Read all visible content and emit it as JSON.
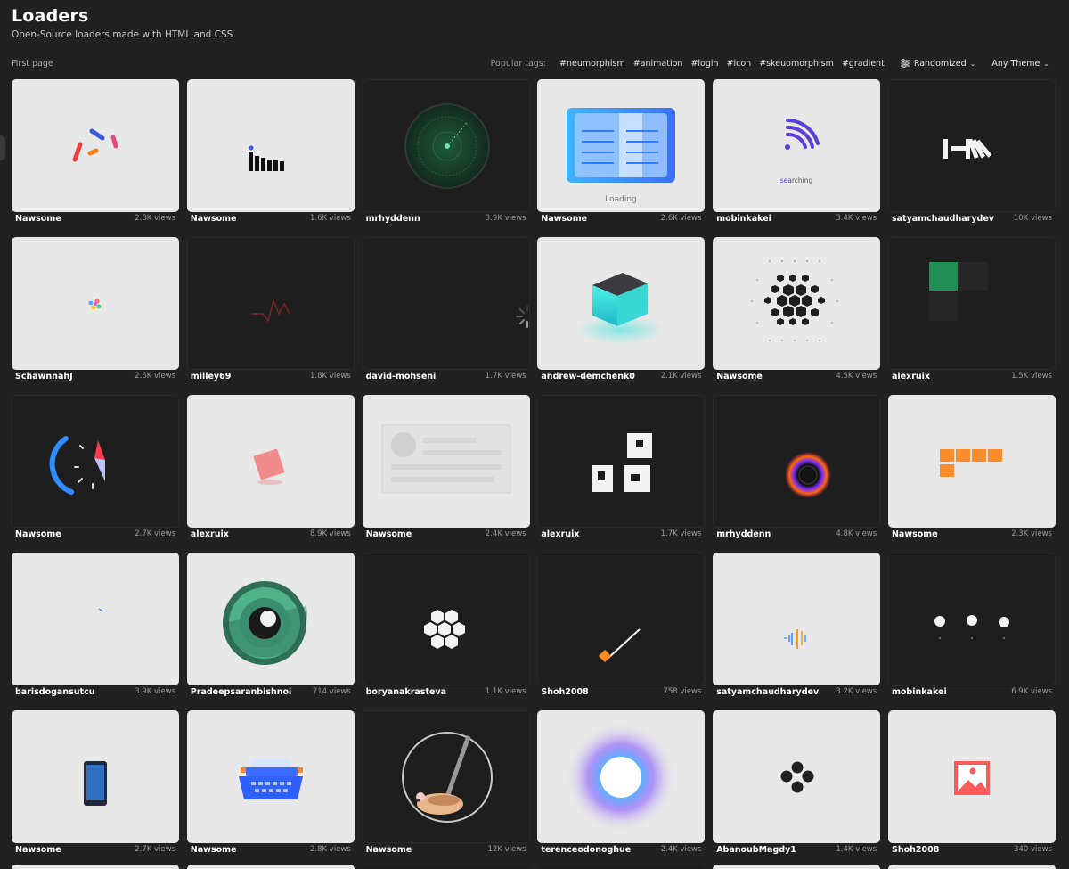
{
  "header": {
    "title": "Loaders",
    "subtitle": "Open-Source loaders made with HTML and CSS"
  },
  "toolbar": {
    "first_page": "First page",
    "popular_label": "Popular tags:",
    "tags": [
      "#neumorphism",
      "#animation",
      "#login",
      "#icon",
      "#skeuomorphism",
      "#gradient"
    ],
    "sort_label": "Randomized",
    "theme_label": "Any Theme"
  },
  "cards": [
    {
      "author": "Nawsome",
      "views": "2.8K views",
      "theme": "light",
      "art": "dashes"
    },
    {
      "author": "Nawsome",
      "views": "1.6K views",
      "theme": "light",
      "art": "bars"
    },
    {
      "author": "mrhyddenn",
      "views": "3.9K views",
      "theme": "dark",
      "art": "radar"
    },
    {
      "author": "Nawsome",
      "views": "2.6K views",
      "theme": "light",
      "art": "book",
      "text": "Loading"
    },
    {
      "author": "mobinkakei",
      "views": "3.4K views",
      "theme": "light",
      "art": "wifi",
      "text": "searching"
    },
    {
      "author": "satyamchaudharydev",
      "views": "10K views",
      "theme": "dark",
      "art": "domino"
    },
    {
      "author": "SchawnnahJ",
      "views": "2.6K views",
      "theme": "light",
      "art": "dots"
    },
    {
      "author": "milley69",
      "views": "1.8K views",
      "theme": "dark",
      "art": "pulse"
    },
    {
      "author": "david-mohseni",
      "views": "1.7K views",
      "theme": "dark",
      "art": "spinner"
    },
    {
      "author": "andrew-demchenk0",
      "views": "2.1K views",
      "theme": "light",
      "art": "cube"
    },
    {
      "author": "Nawsome",
      "views": "4.5K views",
      "theme": "light",
      "art": "hexgrid"
    },
    {
      "author": "alexruix",
      "views": "1.5K views",
      "theme": "dark",
      "art": "squares"
    },
    {
      "author": "Nawsome",
      "views": "2.7K views",
      "theme": "dark",
      "art": "compass"
    },
    {
      "author": "alexruix",
      "views": "8.9K views",
      "theme": "light",
      "art": "pinkbox"
    },
    {
      "author": "Nawsome",
      "views": "2.4K views",
      "theme": "light",
      "art": "skeleton"
    },
    {
      "author": "alexruix",
      "views": "1.7K views",
      "theme": "dark",
      "art": "blocks"
    },
    {
      "author": "mrhyddenn",
      "views": "4.8K views",
      "theme": "dark",
      "art": "ring"
    },
    {
      "author": "Nawsome",
      "views": "2.3K views",
      "theme": "light",
      "art": "orangeblocks"
    },
    {
      "author": "barisdogansutcu",
      "views": "3.9K views",
      "theme": "light",
      "art": "tick"
    },
    {
      "author": "Pradeepsaranbishnoi",
      "views": "714 views",
      "theme": "light",
      "art": "eye"
    },
    {
      "author": "boryanakrasteva",
      "views": "1.1K views",
      "theme": "dark",
      "art": "honeycomb"
    },
    {
      "author": "Shoh2008",
      "views": "758 views",
      "theme": "dark",
      "art": "stick"
    },
    {
      "author": "satyamchaudharydev",
      "views": "3.2K views",
      "theme": "light",
      "art": "equalizer"
    },
    {
      "author": "mobinkakei",
      "views": "6.9K views",
      "theme": "dark",
      "art": "threedots"
    },
    {
      "author": "Nawsome",
      "views": "2.7K views",
      "theme": "light",
      "art": "phone"
    },
    {
      "author": "Nawsome",
      "views": "2.8K views",
      "theme": "light",
      "art": "typewriter"
    },
    {
      "author": "Nawsome",
      "views": "12K views",
      "theme": "dark",
      "art": "hamster"
    },
    {
      "author": "terenceodonoghue",
      "views": "2.4K views",
      "theme": "light",
      "art": "glow"
    },
    {
      "author": "AbanoubMagdy1",
      "views": "1.4K views",
      "theme": "light",
      "art": "fourdots"
    },
    {
      "author": "Shoh2008",
      "views": "340 views",
      "theme": "light",
      "art": "image"
    }
  ],
  "partial_row_themes": [
    "light",
    "light",
    "dark",
    "dark",
    "light",
    "light"
  ]
}
